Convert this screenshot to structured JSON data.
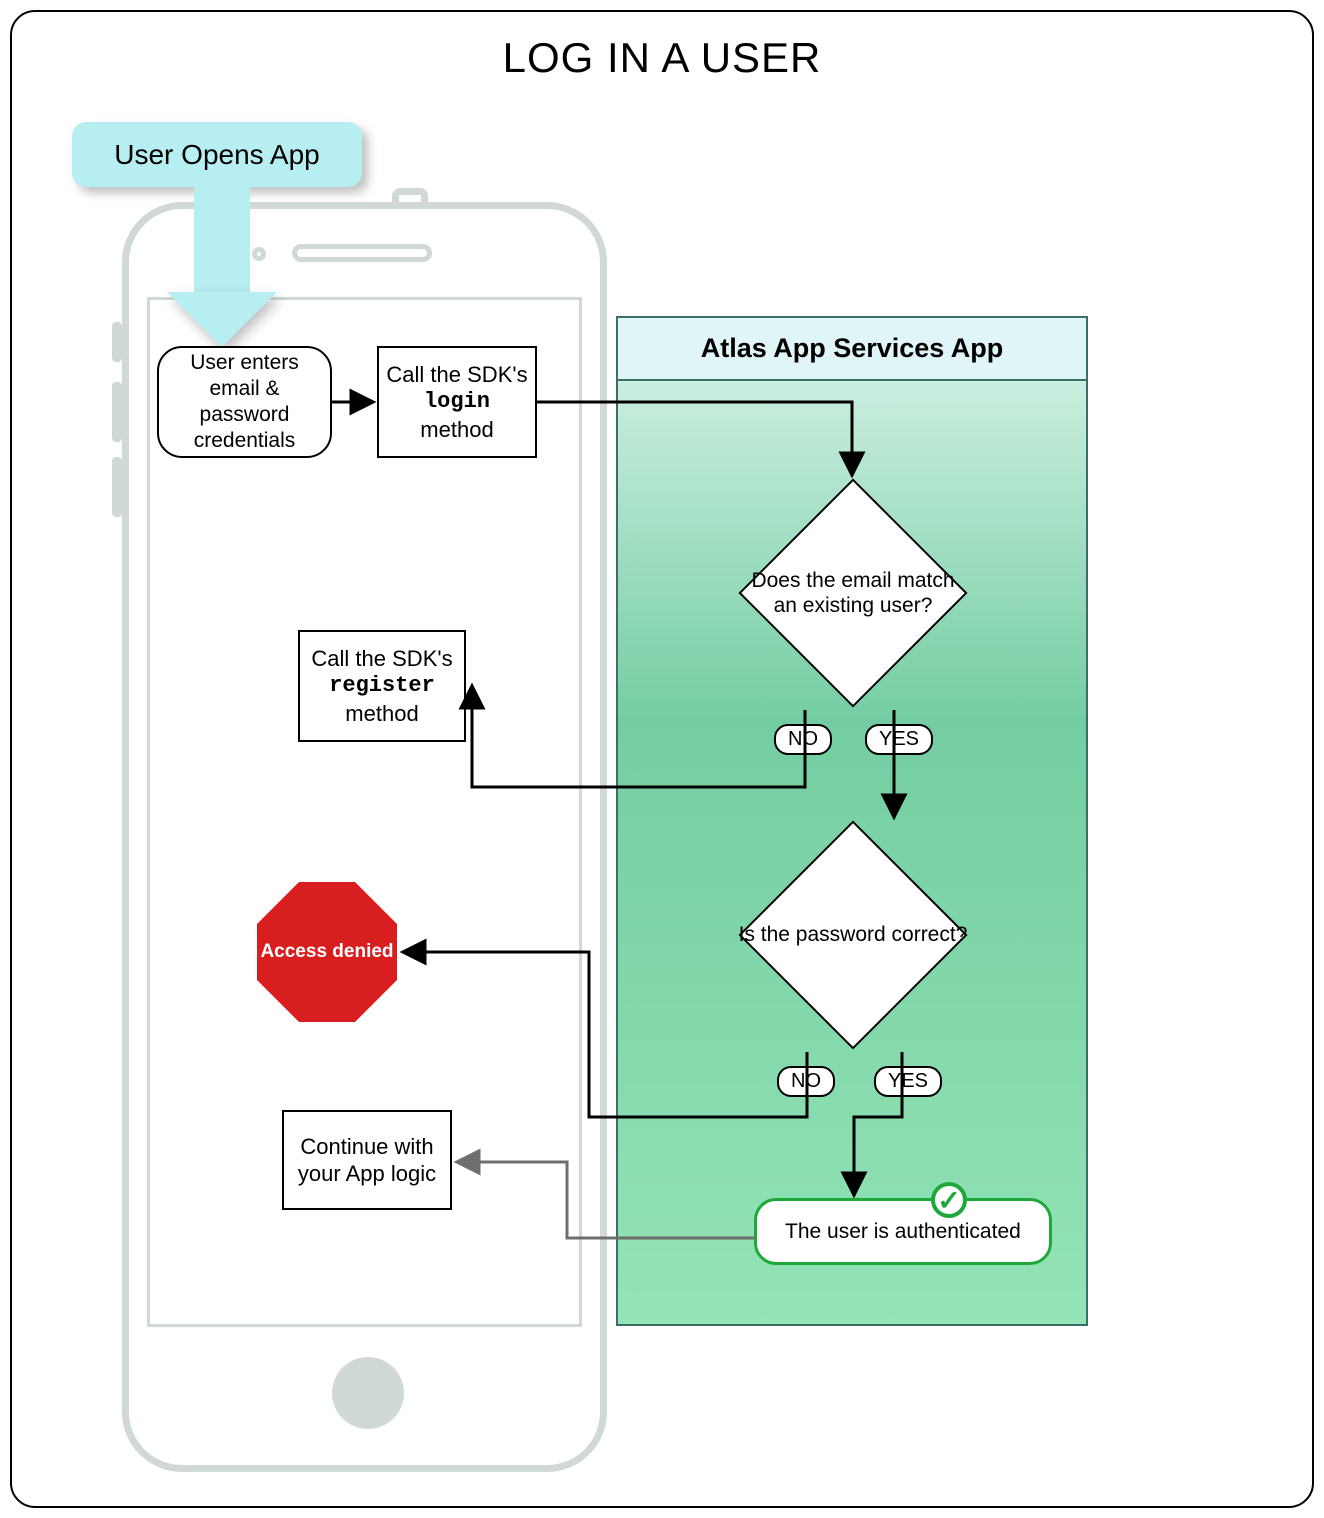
{
  "title": "LOG IN A USER",
  "opens_app": "User Opens App",
  "server_title": "Atlas App Services App",
  "boxes": {
    "enter_creds": "User enters email & password credentials",
    "call_login_pre": "Call the SDK's",
    "call_login_code": "login",
    "call_login_post": "method",
    "call_register_pre": "Call the SDK's",
    "call_register_code": "register",
    "call_register_post": "method",
    "access_denied": "Access denied",
    "continue": "Continue with your App logic",
    "authenticated": "The user is authenticated"
  },
  "decisions": {
    "email_match": "Does the email match an existing user?",
    "password_correct": "Is the password correct?"
  },
  "labels": {
    "yes": "YES",
    "no": "NO"
  }
}
